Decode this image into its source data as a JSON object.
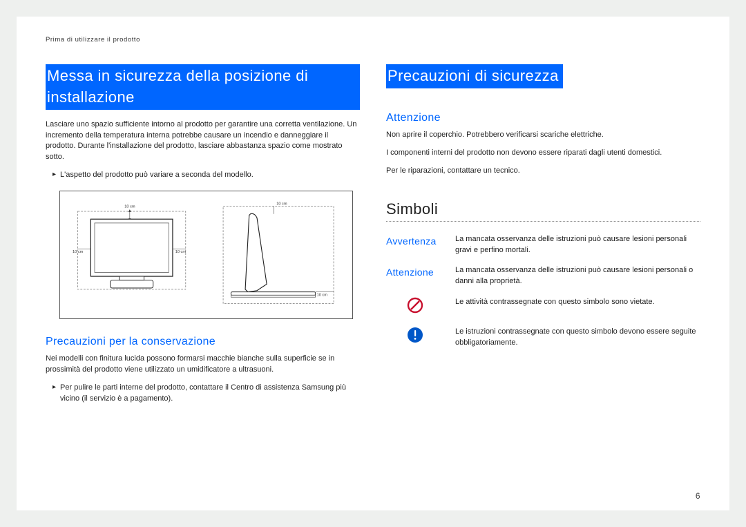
{
  "header": "Prima di utilizzare il prodotto",
  "page_number": "6",
  "left": {
    "title": "Messa in sicurezza della posizione di installazione",
    "intro": "Lasciare uno spazio sufficiente intorno al prodotto per garantire una corretta ventilazione. Un incremento della temperatura interna potrebbe causare un incendio e danneggiare il prodotto. Durante l'installazione del prodotto, lasciare abbastanza spazio come mostrato sotto.",
    "note": "L'aspetto del prodotto può variare a seconda del modello.",
    "diag_measure": "10 cm",
    "subheading": "Precauzioni per la conservazione",
    "sub_para": "Nei modelli con finitura lucida possono formarsi macchie bianche sulla superficie se in prossimità del prodotto viene utilizzato un umidificatore a ultrasuoni.",
    "sub_note": "Per pulire le parti interne del prodotto, contattare il Centro di assistenza Samsung più vicino (il servizio è a pagamento)."
  },
  "right": {
    "title": "Precauzioni di sicurezza",
    "caution_heading": "Attenzione",
    "caution_lines": [
      "Non aprire il coperchio. Potrebbero verificarsi scariche elettriche.",
      "I componenti interni del prodotto non devono essere riparati dagli utenti domestici.",
      "Per le riparazioni, contattare un tecnico."
    ],
    "symbols_heading": "Simboli",
    "rows": [
      {
        "label": "Avvertenza",
        "text": "La mancata osservanza delle istruzioni può causare lesioni personali gravi e perfino mortali."
      },
      {
        "label": "Attenzione",
        "text": "La mancata osservanza delle istruzioni può causare lesioni personali o danni alla proprietà."
      },
      {
        "icon": "prohibit",
        "text": "Le attività contrassegnate con questo simbolo sono vietate."
      },
      {
        "icon": "must",
        "text": "Le istruzioni contrassegnate con questo simbolo devono essere seguite obbligatoriamente."
      }
    ]
  }
}
